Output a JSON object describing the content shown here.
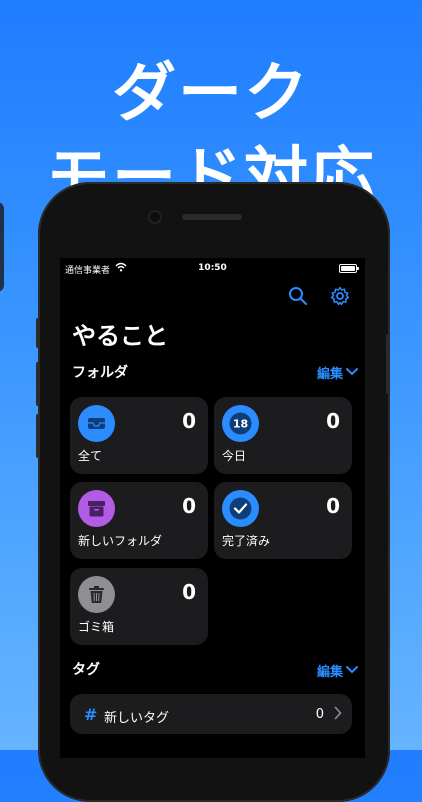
{
  "headline": {
    "line1": "ダーク",
    "line2": "モード対応"
  },
  "status_bar": {
    "carrier": "通信事業者",
    "time": "10:50"
  },
  "toolbar": {
    "search_icon": "search-icon",
    "settings_icon": "gear-icon"
  },
  "page": {
    "title": "やること"
  },
  "folders": {
    "section_label": "フォルダ",
    "edit_label": "編集",
    "items": [
      {
        "label": "全て",
        "count": "0",
        "icon": "tray-icon",
        "color": "#2b8cff"
      },
      {
        "label": "今日",
        "count": "0",
        "icon": "calendar-icon",
        "color": "#2b8cff",
        "badge": "18"
      },
      {
        "label": "新しいフォルダ",
        "count": "0",
        "icon": "archive-box-icon",
        "color": "#b25ce6"
      },
      {
        "label": "完了済み",
        "count": "0",
        "icon": "checkmark-icon",
        "color": "#2b8cff"
      },
      {
        "label": "ゴミ箱",
        "count": "0",
        "icon": "trash-icon",
        "color": "#8e8e93"
      }
    ]
  },
  "tags": {
    "section_label": "タグ",
    "edit_label": "編集",
    "items": [
      {
        "label": "新しいタグ",
        "count": "0",
        "symbol": "#"
      }
    ]
  },
  "colors": {
    "accent": "#2a8cff",
    "card_bg": "#1c1c1e",
    "screen_bg": "#000000"
  }
}
